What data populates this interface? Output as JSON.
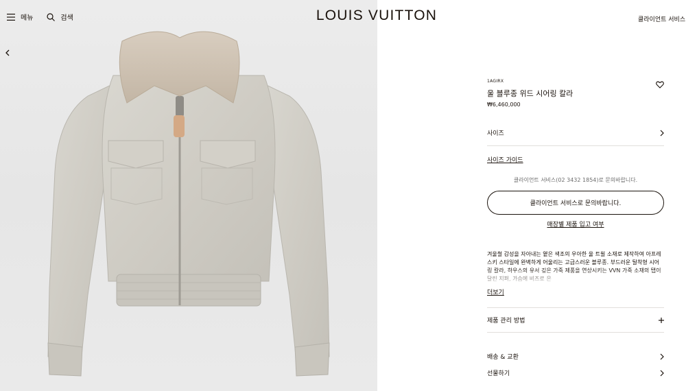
{
  "header": {
    "menu_label": "메뉴",
    "search_label": "검색",
    "logo": "LOUIS VUITTON",
    "client_services": "클라이언트 서비스"
  },
  "product": {
    "sku": "1AGIRX",
    "name": "울 블루종 위드 시어링 칼라",
    "price": "₩6,460,000",
    "size_label": "사이즈",
    "size_guide": "사이즈 가이드",
    "client_service_note": "클라이언트 서비스(02 3432 1854)로 문의바랍니다.",
    "cta_label": "클라이언트 서비스로 문의바랍니다.",
    "store_stock": "매장별 제품 입고 여부",
    "description": "겨울철 감성을 자아내는 옅은 색조의 우아한 울 트윌 소재로 제작하여 아프레 스키 스타일에 완벽하게 어울리는 고급스러운 블루종. 부드러운 탈착형 시어링 칼라, 하우스의 유서 깊은 가죽 제품을 연상시키는 VVN 가죽 소재의 탭이 달린 지퍼, 가슴에 비즈로 은",
    "read_more": "더보기",
    "care_label": "제품 관리 방법",
    "shipping_label": "배송 & 교환",
    "gift_label": "선물하기"
  },
  "icons": {
    "menu": "hamburger-icon",
    "search": "search-icon",
    "back": "chevron-left-icon",
    "wishlist": "heart-icon",
    "chevron": "chevron-right-icon",
    "expand": "plus-icon"
  },
  "colors": {
    "text": "#19110b",
    "divider": "#e1dfdc",
    "muted": "#6d6d6d",
    "image_bg": "#e8e8e8"
  }
}
